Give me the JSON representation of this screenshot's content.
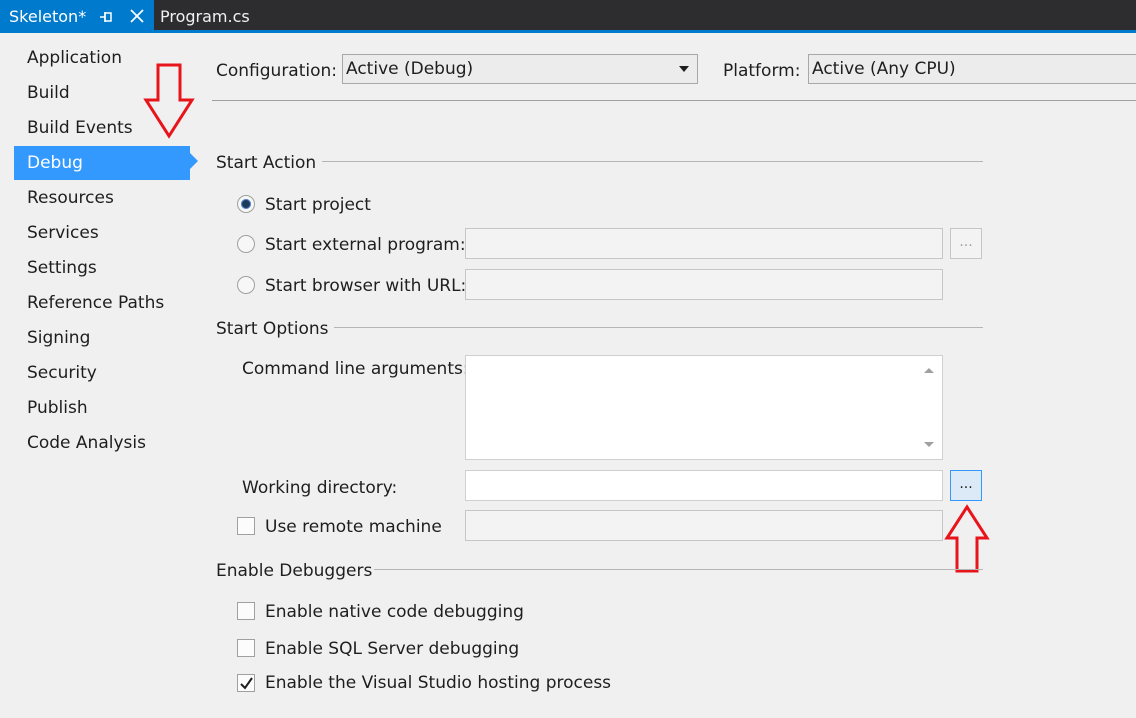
{
  "tabs": [
    {
      "title": "Skeleton*",
      "active": true
    },
    {
      "title": "Program.cs",
      "active": false
    }
  ],
  "nav": {
    "items": [
      "Application",
      "Build",
      "Build Events",
      "Debug",
      "Resources",
      "Services",
      "Settings",
      "Reference Paths",
      "Signing",
      "Security",
      "Publish",
      "Code Analysis"
    ],
    "selected": "Debug"
  },
  "config": {
    "configuration_label": "Configuration:",
    "configuration_value": "Active (Debug)",
    "platform_label": "Platform:",
    "platform_value": "Active (Any CPU)"
  },
  "start_action": {
    "heading": "Start Action",
    "start_project": "Start project",
    "start_external": "Start external program:",
    "start_browser": "Start browser with URL:",
    "browse_label": "..."
  },
  "start_options": {
    "heading": "Start Options",
    "cmd_args_label": "Command line arguments:",
    "working_dir_label": "Working directory:",
    "browse_label": "...",
    "remote_label": "Use remote machine"
  },
  "debuggers": {
    "heading": "Enable Debuggers",
    "native": "Enable native code debugging",
    "sql": "Enable SQL Server debugging",
    "hosting": "Enable the Visual Studio hosting process",
    "native_checked": false,
    "sql_checked": false,
    "hosting_checked": true
  },
  "colors": {
    "accent": "#007acc",
    "selection": "#3399ff",
    "annotation": "#e8141b"
  }
}
